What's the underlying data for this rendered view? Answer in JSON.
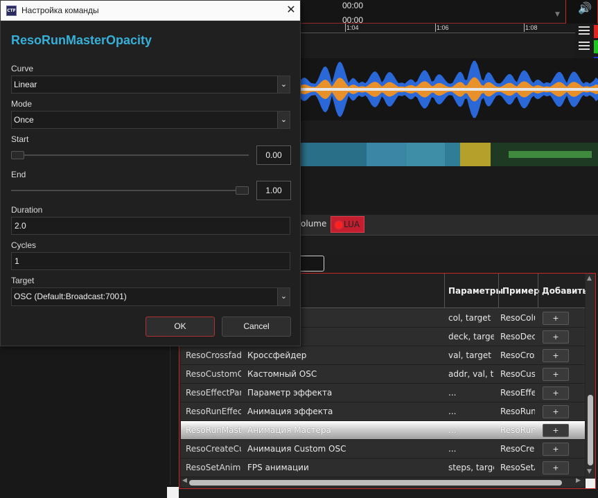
{
  "background": {
    "timecodes": [
      "00:00",
      "00:00"
    ],
    "ruler_labels": [
      "1:04",
      "1:06",
      "1:08"
    ],
    "channel_colors": [
      "#e0261f",
      "#22c422",
      "#1e3ad8",
      "#f2e21a"
    ],
    "tabs": {
      "volume_label": "olume",
      "lua_label": "LUA"
    },
    "table": {
      "headers": [
        "Параметры",
        "Пример",
        "Добавить"
      ],
      "rows": [
        {
          "name": "",
          "desc": "ки",
          "params": "col, target",
          "example": "ResoColu",
          "add": "+",
          "selected": false
        },
        {
          "name": "",
          "desc": "",
          "params": "deck, target",
          "example": "ResoDecl",
          "add": "+",
          "selected": false
        },
        {
          "name": "ResoCrossfade",
          "desc": "Кроссфейдер",
          "params": "val, target",
          "example": "ResoCros",
          "add": "+",
          "selected": false
        },
        {
          "name": "ResoCustomOS",
          "desc": "Кастомный OSC",
          "params": "addr, val, tar",
          "example": "ResoCust",
          "add": "+",
          "selected": false
        },
        {
          "name": "ResoEffectPara",
          "desc": "Параметр эффекта",
          "params": "...",
          "example": "ResoEffec",
          "add": "+",
          "selected": false
        },
        {
          "name": "ResoRunEffect",
          "desc": "Анимация эффекта",
          "params": "...",
          "example": "ResoRunI",
          "add": "+",
          "selected": false
        },
        {
          "name": "ResoRunMaste",
          "desc": "Анимация Мастера",
          "params": "...",
          "example": "ResoRunI",
          "add": "+",
          "selected": true
        },
        {
          "name": "ResoCreateCus",
          "desc": "Анимация Custom OSC",
          "params": "...",
          "example": "ResoCrea",
          "add": "+",
          "selected": false
        },
        {
          "name": "ResoSetAnimat",
          "desc": "FPS анимации",
          "params": "steps, target",
          "example": "ResoSetA",
          "add": "+",
          "selected": false
        }
      ]
    }
  },
  "dialog": {
    "window_title": "Настройка команды",
    "app_icon_text": "CTF",
    "command_name": "ResoRunMasterOpacity",
    "curve": {
      "label": "Curve",
      "value": "Linear"
    },
    "mode": {
      "label": "Mode",
      "value": "Once"
    },
    "start": {
      "label": "Start",
      "value": "0.00",
      "level": 0.0
    },
    "end": {
      "label": "End",
      "value": "1.00",
      "level": 1.0
    },
    "duration": {
      "label": "Duration",
      "value": "2.0"
    },
    "cycles": {
      "label": "Cycles",
      "value": "1"
    },
    "target": {
      "label": "Target",
      "value": "OSC (Default:Broadcast:7001)"
    },
    "ok_label": "OK",
    "cancel_label": "Cancel"
  }
}
